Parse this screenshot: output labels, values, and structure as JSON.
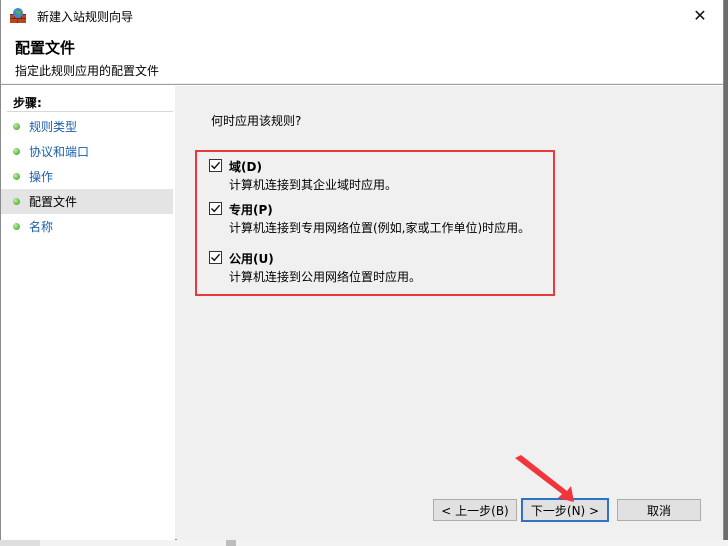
{
  "window": {
    "title": "新建入站规则向导",
    "close_glyph": "✕"
  },
  "header": {
    "title": "配置文件",
    "description": "指定此规则应用的配置文件"
  },
  "steps": {
    "label": "步骤:",
    "items": [
      {
        "label": "规则类型",
        "active": false
      },
      {
        "label": "协议和端口",
        "active": false
      },
      {
        "label": "操作",
        "active": false
      },
      {
        "label": "配置文件",
        "active": true
      },
      {
        "label": "名称",
        "active": false
      }
    ]
  },
  "content": {
    "question": "何时应用该规则?",
    "options": [
      {
        "title": "域(D)",
        "description": "计算机连接到其企业域时应用。",
        "checked": true
      },
      {
        "title": "专用(P)",
        "description": "计算机连接到专用网络位置(例如,家或工作单位)时应用。",
        "checked": true
      },
      {
        "title": "公用(U)",
        "description": "计算机连接到公用网络位置时应用。",
        "checked": true
      }
    ]
  },
  "buttons": {
    "back": "< 上一步(B)",
    "next": "下一步(N) >",
    "cancel": "取消"
  },
  "colors": {
    "highlight_border": "#e63a3f",
    "arrow": "#f0353c",
    "step_link": "#1c5ea8",
    "default_button_border": "#2d72c6"
  }
}
